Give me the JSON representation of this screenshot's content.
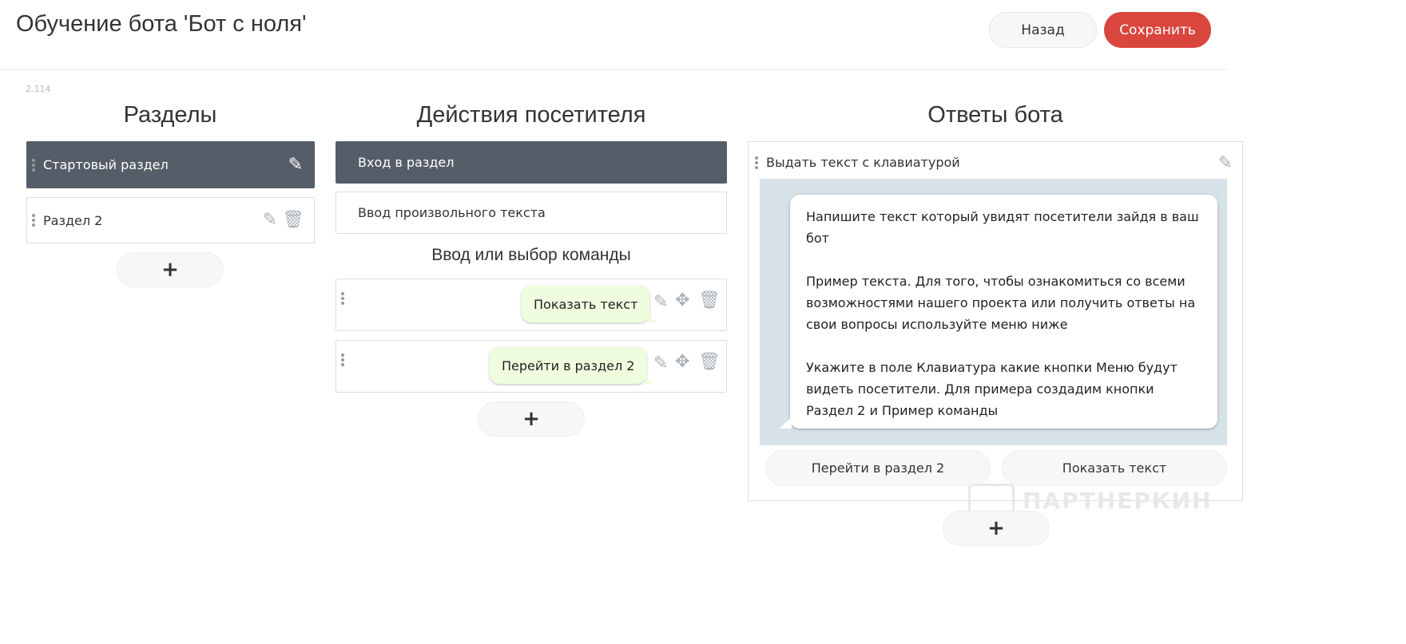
{
  "header": {
    "title": "Обучение бота 'Бот с ноля'",
    "back_label": "Назад",
    "save_label": "Сохранить",
    "version": "2.114"
  },
  "sections": {
    "heading": "Разделы",
    "items": [
      {
        "label": "Стартовый раздел",
        "active": true
      },
      {
        "label": "Раздел 2",
        "active": false
      }
    ],
    "add_label": "+"
  },
  "actions": {
    "heading": "Действия посетителя",
    "items": [
      {
        "label": "Вход в раздел",
        "active": true
      },
      {
        "label": "Ввод произвольного текста",
        "active": false
      }
    ],
    "subheading": "Ввод или выбор команды",
    "commands": [
      {
        "label": "Показать текст"
      },
      {
        "label": "Перейти в раздел 2"
      }
    ],
    "add_label": "+"
  },
  "answers": {
    "heading": "Ответы бота",
    "card_title": "Выдать текст с клавиатурой",
    "message": "Напишите текст который увидят посетители зайдя в ваш бот\n\nПример текста. Для того, чтобы ознакомиться со всеми возможностями нашего проекта или получить ответы на свои вопросы используйте меню ниже\n\nУкажите в поле Клавиатура какие кнопки Меню будут видеть посетители. Для примера создадим кнопки Раздел 2 и Пример команды",
    "keyboard": [
      "Перейти в раздел 2",
      "Показать текст"
    ],
    "add_label": "+"
  },
  "watermark": "ПАРТНЕРКИН",
  "colors": {
    "active": "#555d68",
    "save": "#d9463e",
    "bubble": "#effdde"
  }
}
